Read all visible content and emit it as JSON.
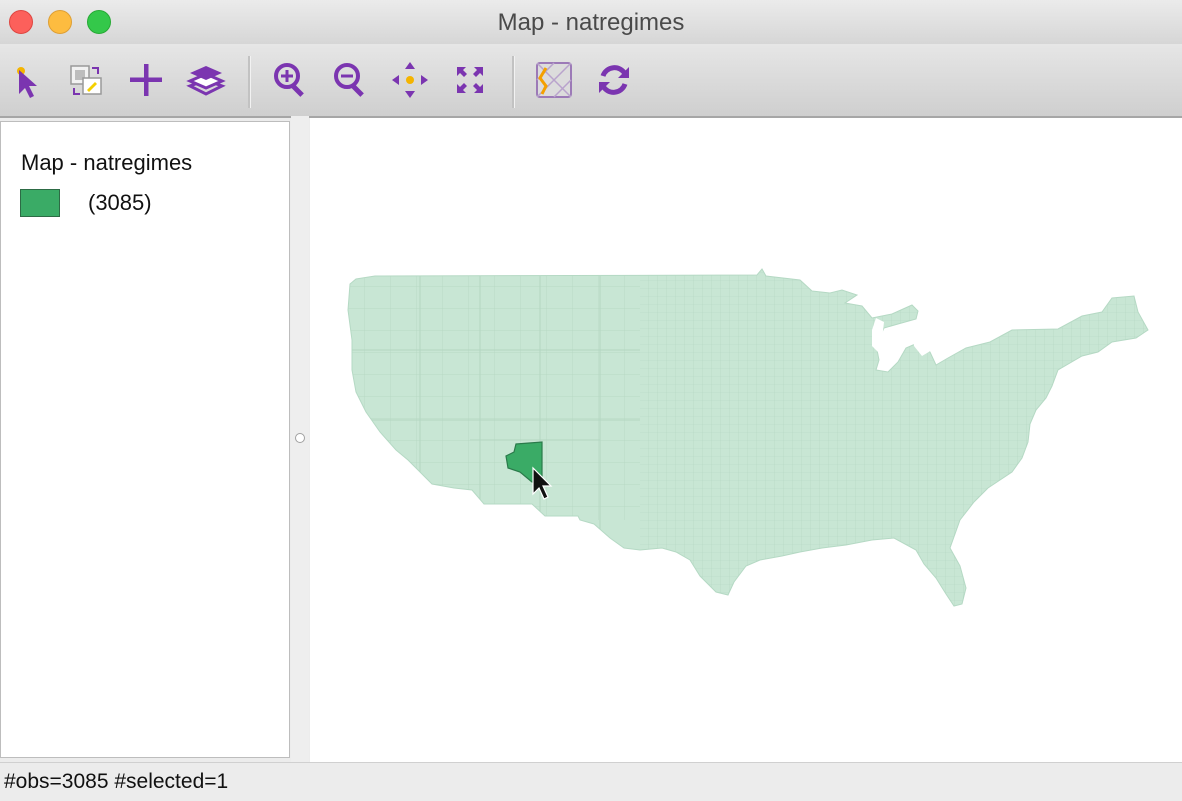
{
  "window": {
    "title": "Map - natregimes"
  },
  "toolbar": {
    "icons": [
      "select-pointer-icon",
      "selection-shape-icon",
      "add-layer-icon",
      "layers-icon",
      "zoom-in-icon",
      "zoom-out-icon",
      "pan-icon",
      "full-extent-icon",
      "basemap-icon",
      "refresh-icon"
    ],
    "accent_color": "#7b35b0"
  },
  "legend": {
    "title": "Map - natregimes",
    "categories": [
      {
        "count": "(3085)",
        "color": "#3aab66"
      }
    ]
  },
  "map": {
    "fill_color": "#c8e6d4",
    "selected_color": "#3aab66",
    "selected_feature": "county-in-arizona"
  },
  "status": {
    "text": "#obs=3085 #selected=1"
  }
}
